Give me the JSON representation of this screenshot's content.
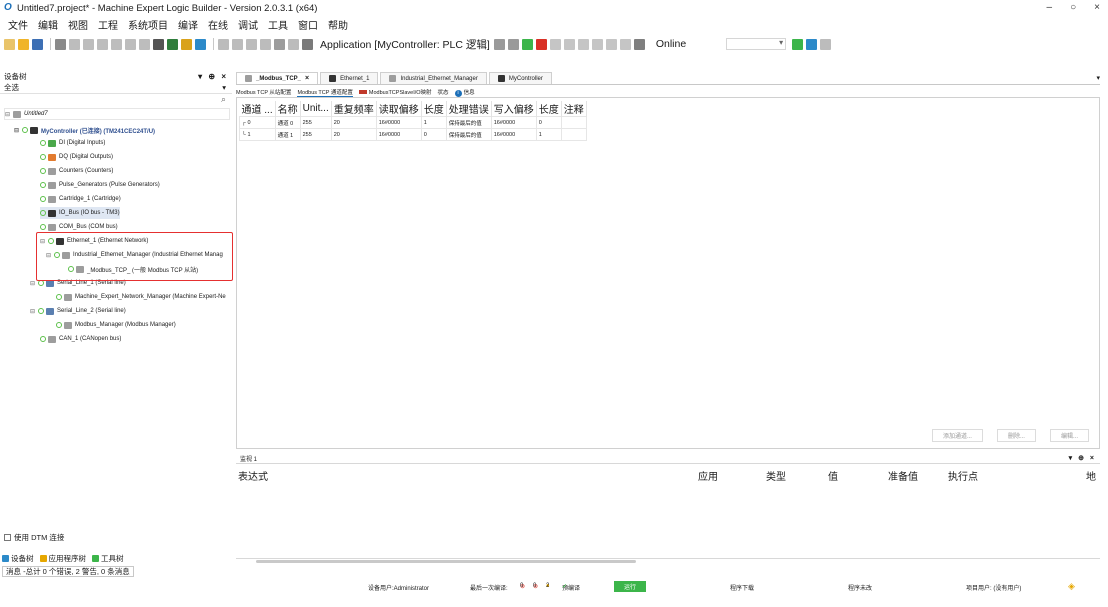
{
  "window": {
    "title": "Untitled7.project* - Machine Expert Logic Builder - Version 2.0.3.1 (x64)",
    "controls": [
      "–",
      "○",
      "×"
    ]
  },
  "menu": [
    "文件",
    "编辑",
    "视图",
    "工程",
    "系统项目",
    "编译",
    "在线",
    "调试",
    "工具",
    "窗口",
    "帮助"
  ],
  "toolbar": {
    "application_label": "Application [MyController: PLC 逻辑]",
    "online_label": "Online"
  },
  "device_tree": {
    "title": "设备树",
    "controls": "▾ ⊕ ×",
    "filter": "全选",
    "root": "Untitled7",
    "controller": "MyController (已连接) (TM241CEC24T/U)",
    "items": [
      {
        "label": "DI (Digital Inputs)"
      },
      {
        "label": "DQ (Digital Outputs)"
      },
      {
        "label": "Counters (Counters)"
      },
      {
        "label": "Pulse_Generators (Pulse Generators)"
      },
      {
        "label": "Cartridge_1 (Cartridge)"
      },
      {
        "label": "IO_Bus (IO bus - TM3)"
      },
      {
        "label": "COM_Bus (COM bus)"
      },
      {
        "label": "Ethernet_1 (Ethernet Network)"
      },
      {
        "label": "Industrial_Ethernet_Manager (Industrial Ethernet Manag"
      },
      {
        "label": "_Modbus_TCP_ (一般 Modbus TCP 从站)"
      },
      {
        "label": "Serial_Line_1 (Serial line)"
      },
      {
        "label": "Machine_Expert_Network_Manager (Machine Expert-Ne"
      },
      {
        "label": "Serial_Line_2 (Serial line)"
      },
      {
        "label": "Modbus_Manager (Modbus Manager)"
      },
      {
        "label": "CAN_1 (CANopen bus)"
      }
    ],
    "dtm_checkbox": "使用 DTM 连接",
    "bottom_tabs": [
      "设备树",
      "应用程序树",
      "工具树"
    ],
    "messages": "消息 -总计 0 个错误, 2 警告, 0 条消息"
  },
  "editor": {
    "tabs": [
      "_Modbus_TCP_",
      "Ethernet_1",
      "Industrial_Ethernet_Manager",
      "MyController"
    ],
    "close_glyph": "×",
    "subtabs": [
      "Modbus TCP 从站配置",
      "Modbus TCP 通道配置",
      "ModbusTCPSlaveI/O映射",
      "状态",
      "信息"
    ],
    "table": {
      "headers": [
        "通道 ...",
        "名称",
        "Unit...",
        "重复频率",
        "读取偏移",
        "长度",
        "处理错误",
        "写入偏移",
        "长度",
        "注释"
      ],
      "rows": [
        [
          "0",
          "通道 0",
          "255",
          "20",
          "16#0000",
          "1",
          "保持最后的值",
          "16#0000",
          "0",
          ""
        ],
        [
          "1",
          "通道 1",
          "255",
          "20",
          "16#0000",
          "0",
          "保持最后的值",
          "16#0000",
          "1",
          ""
        ]
      ]
    },
    "actions": [
      "添加通道...",
      "删除...",
      "编辑..."
    ]
  },
  "watch": {
    "title": "监视 1",
    "controls": "▾ ⊕ ×",
    "columns": [
      "表达式",
      "应用",
      "类型",
      "值",
      "准备值",
      "执行点",
      "地"
    ]
  },
  "status": {
    "user": "设备用户:Administrator",
    "last_compile": "最后一次编译:",
    "errors": "0",
    "warnings_a": "0",
    "warnings_b": "2",
    "precompile": "预编译",
    "run": "运行",
    "download": "程序下载",
    "changed": "程序未改",
    "project_user": "项目用户: (没有用户)"
  }
}
